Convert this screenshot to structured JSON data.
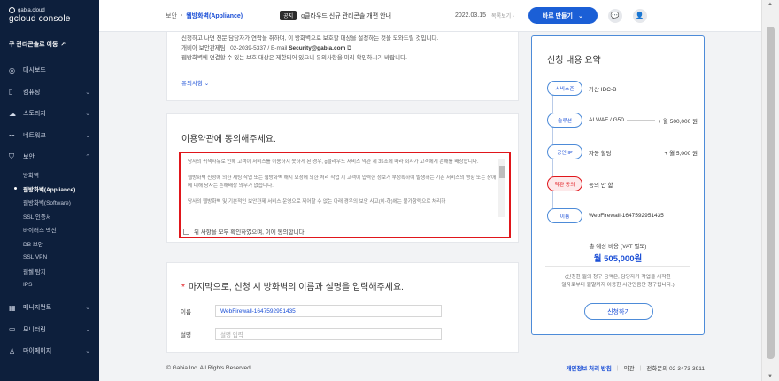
{
  "brand": {
    "small": "gabia.cloud",
    "big": "gcloud console"
  },
  "to_old": "구 관리콘솔로 이동",
  "nav": [
    {
      "label": "대시보드",
      "icon": "dashboard-icon",
      "glyph": "◎",
      "chev": ""
    },
    {
      "label": "컴퓨팅",
      "icon": "compute-icon",
      "glyph": "▯",
      "chev": "⌄"
    },
    {
      "label": "스토리지",
      "icon": "storage-icon",
      "glyph": "☁",
      "chev": "⌄"
    },
    {
      "label": "네트워크",
      "icon": "network-icon",
      "glyph": "⊹",
      "chev": "⌄"
    },
    {
      "label": "보안",
      "icon": "shield-icon",
      "glyph": "⛉",
      "chev": "⌃"
    }
  ],
  "security_sub": [
    "방화벽",
    "웹방화벽(Appliance)",
    "웹방화벽(Software)",
    "SSL 인증서",
    "바이러스 백신",
    "DB 보안",
    "SSL VPN",
    "웹쉘 탐지",
    "IPS"
  ],
  "nav_bottom": [
    {
      "label": "매니지먼트",
      "icon": "management-icon",
      "glyph": "▦",
      "chev": "⌄"
    },
    {
      "label": "모니터링",
      "icon": "monitor-icon",
      "glyph": "▭",
      "chev": "⌄"
    },
    {
      "label": "마이페이지",
      "icon": "user-icon",
      "glyph": "♙",
      "chev": "⌄"
    }
  ],
  "topbar": {
    "crumb_root": "보안",
    "crumb_sep": "›",
    "crumb_current": "웹방화벽(Appliance)",
    "notice_tag": "공지",
    "notice_text": "g클라우드 신규 관리콘솔 개편 안내",
    "notice_date": "2022.03.15",
    "notice_list": "목록보기 ›",
    "go_button": "바로 만들기",
    "go_chev": "⌄"
  },
  "card1": {
    "line1": "신청하고 나면 전문 담당자가 연락을 취하며, 이 방화벽으로 보호할 대상을 설정하는 것을 도와드릴 것입니다.",
    "line2_prefix": "개비아 보안관제팀 : 02-2039-5337 / E-mail ",
    "line2_email": "Security@gabia.com",
    "line3": "웹방화벽에 연결할 수 있는 보호 대상은 제한되어 있으니 유의사항을 미리 확인하시기 바랍니다.",
    "more": "유의사항 ⌄"
  },
  "card2": {
    "title": "이용약관에 동의해주세요.",
    "p1": "당사의 귀책사유로 인해 고객이 서비스를 이용하지 못하게 된 경우, g클라우드 서비스 약관 제 35조에 따라 회사가 고객에게 손해를 배상합니다.",
    "p2": "웹방화벽 신청에 의한 세팅 작업 또는 웹방화벽 해지 요청에 의한 처리 작업 시 고객이 입력한 정보가 부정확하여 발생하는 기존 서비스의 영향 또는 장애에 대해 당사는 손해배상 의무가 없습니다.",
    "p3": "당사의 웹방화벽 및 기본적인 보안관제 서비스 운영으로 제어할 수 없는 아래 경우의 보안 사고(이-하)에는 불가항력으로 처리하",
    "agree": "위 사항을 모두 확인하였으며, 이에 동의합니다."
  },
  "card3": {
    "req": "*",
    "title": "마지막으로, 신청 시 방화벽의 이름과 설명을 입력해주세요.",
    "name_label": "이름",
    "name_value": "WebFirewall-1647592951435",
    "desc_label": "설명",
    "desc_placeholder": "설명 입력"
  },
  "summary": {
    "title": "신청 내용 요약",
    "rows": [
      {
        "pill": "서비스존",
        "value": "가산 IDC-B",
        "price": ""
      },
      {
        "pill": "솔루션",
        "value": "AI WAF / G50",
        "price": "+ 월 500,000 원"
      },
      {
        "pill": "공인 IP",
        "value": "자동 할당",
        "price": "+ 월 5,000 원"
      },
      {
        "pill": "약관 동의",
        "value": "동의 안 함",
        "price": ""
      },
      {
        "pill": "이름",
        "value": "WebFirewall-1647592951435",
        "price": ""
      }
    ],
    "total_label": "총 예상 비용 (VAT 별도)",
    "total_value": "월 505,000원",
    "note1": "(신청한 월의 청구 금액은, 담당자가 작업을 시작한",
    "note2": "일자로부터 월말까지 이용한 시간만큼만 청구됩니다.)",
    "apply": "신청하기"
  },
  "footer": {
    "copyright": "© Gabia Inc. All Rights Reserved.",
    "privacy": "개인정보 처리 방침",
    "terms": "약관",
    "sep": "|",
    "phone": "전화문의 02-3473-3911"
  }
}
